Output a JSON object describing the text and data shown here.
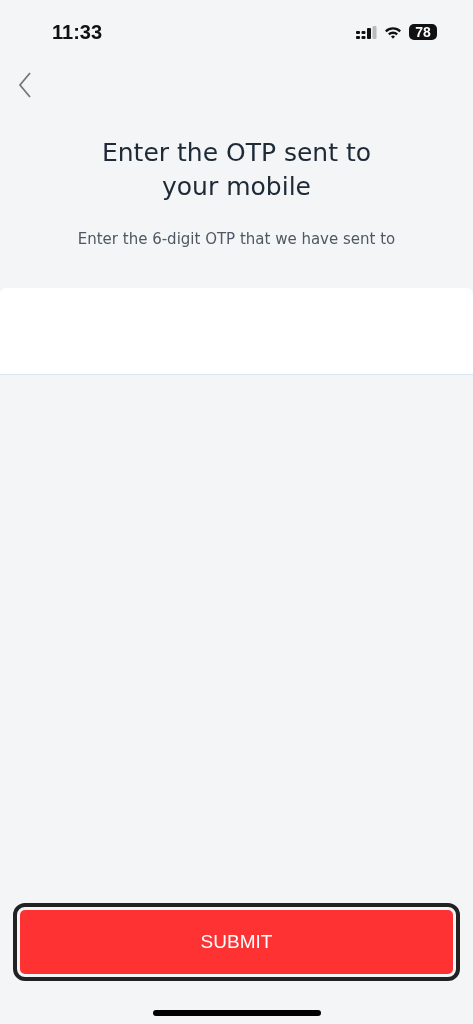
{
  "status_bar": {
    "time": "11:33",
    "battery": "78"
  },
  "title": "Enter the OTP sent to your mobile",
  "subtitle": "Enter the 6-digit OTP that we have sent to",
  "submit_button": {
    "label": "SUBMIT",
    "focused": true
  }
}
